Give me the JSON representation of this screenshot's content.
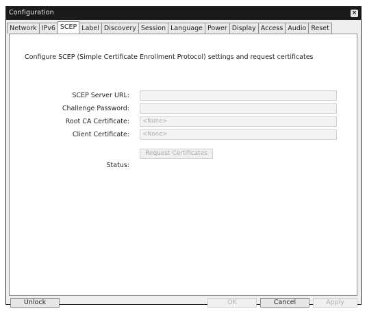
{
  "window": {
    "title": "Configuration",
    "close_glyph": "×"
  },
  "tabs": [
    {
      "label": "Network"
    },
    {
      "label": "IPv6"
    },
    {
      "label": "SCEP",
      "active": true
    },
    {
      "label": "Label"
    },
    {
      "label": "Discovery"
    },
    {
      "label": "Session"
    },
    {
      "label": "Language"
    },
    {
      "label": "Power"
    },
    {
      "label": "Display"
    },
    {
      "label": "Access"
    },
    {
      "label": "Audio"
    },
    {
      "label": "Reset"
    }
  ],
  "scep": {
    "description": "Configure SCEP (Simple Certificate Enrollment Protocol) settings and request certificates",
    "server_url_label": "SCEP Server URL:",
    "server_url_value": "",
    "challenge_password_label": "Challenge Password:",
    "challenge_password_value": "",
    "root_ca_label": "Root CA Certificate:",
    "root_ca_value": "<None>",
    "client_cert_label": "Client Certificate:",
    "client_cert_value": "<None>",
    "request_button": "Request Certificates",
    "status_label": "Status:"
  },
  "buttons": {
    "unlock": "Unlock",
    "ok": "OK",
    "cancel": "Cancel",
    "apply": "Apply"
  }
}
